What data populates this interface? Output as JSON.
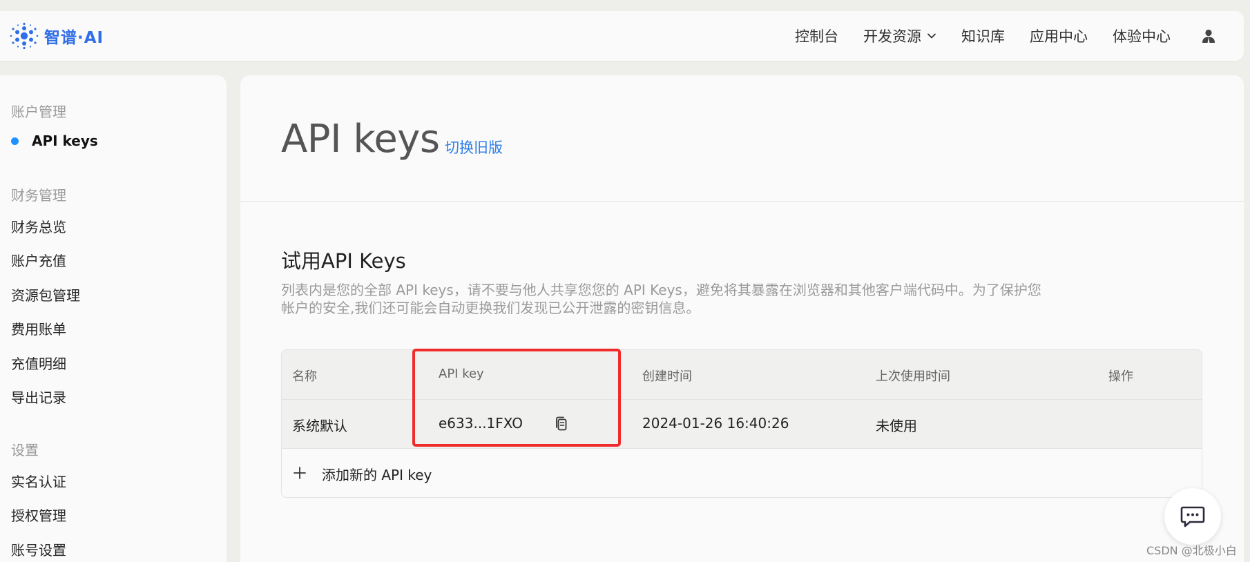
{
  "header": {
    "brand": "智谱·AI",
    "nav": [
      {
        "label": "控制台"
      },
      {
        "label": "开发资源"
      },
      {
        "label": "知识库"
      },
      {
        "label": "应用中心"
      },
      {
        "label": "体验中心"
      }
    ],
    "icons": {
      "logo": "zhipu-logo-icon",
      "dropdown": "chevron-down-icon",
      "user": "user-icon"
    }
  },
  "sidebar": {
    "groups": [
      {
        "title": "账户管理",
        "items": [
          "API keys"
        ]
      },
      {
        "title": "财务管理",
        "items": [
          "财务总览",
          "账户充值",
          "资源包管理",
          "费用账单",
          "充值明细",
          "导出记录"
        ]
      },
      {
        "title": "设置",
        "items": [
          "实名认证",
          "授权管理",
          "账号设置"
        ]
      }
    ],
    "active_item": "API keys"
  },
  "main": {
    "title": "API keys",
    "switch_link": "切换旧版",
    "section_title": "试用API Keys",
    "section_desc": "列表内是您的全部 API keys，请不要与他人共享您您的 API Keys，避免将其暴露在浏览器和其他客户端代码中。为了保护您帐户的安全,我们还可能会自动更换我们发现已公开泄露的密钥信息。",
    "table": {
      "columns": [
        "名称",
        "API key",
        "创建时间",
        "上次使用时间",
        "操作"
      ],
      "rows": [
        {
          "name": "系统默认",
          "key": "e633...1FXO",
          "created": "2024-01-26 16:40:26",
          "last_used": "未使用",
          "action": ""
        }
      ],
      "add_label": "添加新的 API key"
    }
  },
  "colors": {
    "brand": "#2f6ee8",
    "link": "#2f7fe8",
    "active_dot": "#1e90ff",
    "highlight": "#ef2b2b"
  },
  "watermark": "CSDN @北极小白"
}
